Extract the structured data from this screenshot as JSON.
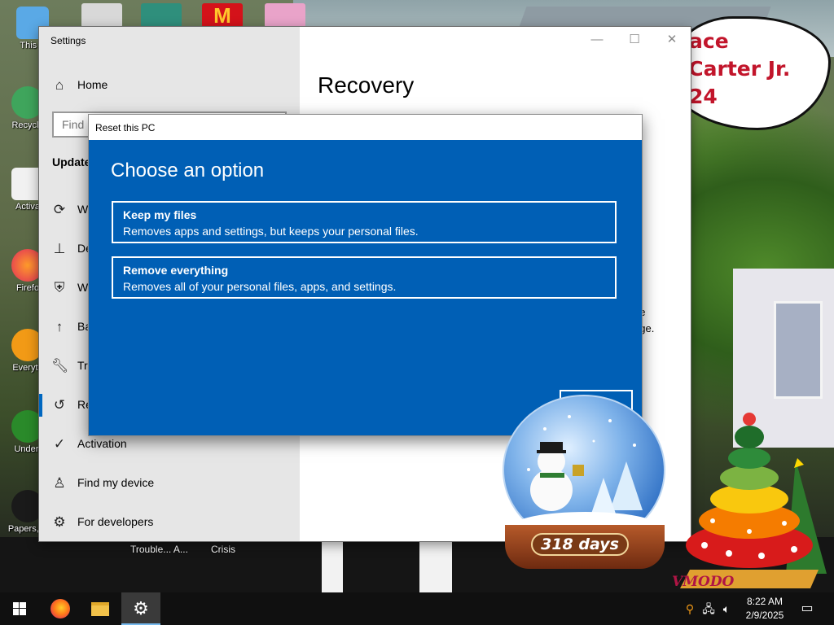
{
  "desktop": {
    "sign_lines": [
      "ace",
      "l Carter Jr.",
      "24"
    ],
    "icons": [
      {
        "label": "This P"
      },
      {
        "label": "Recycle"
      },
      {
        "label": "Activa"
      },
      {
        "label": "Firefo"
      },
      {
        "label": "Everyth"
      },
      {
        "label": "Undert"
      },
      {
        "label": "Papers, P"
      }
    ],
    "floor_labels": [
      "Trouble... A...",
      "Crisis"
    ]
  },
  "settings_window": {
    "title": "Settings",
    "controls": {
      "minimize": "—",
      "maximize": "☐",
      "close": "✕"
    },
    "home_label": "Home",
    "find_placeholder": "Find",
    "section_heading": "Update",
    "nav_items": [
      {
        "label": "W",
        "icon": "sync-icon"
      },
      {
        "label": "De",
        "icon": "delivery-icon"
      },
      {
        "label": "W",
        "icon": "shield-icon"
      },
      {
        "label": "Ba",
        "icon": "backup-icon"
      },
      {
        "label": "Tr",
        "icon": "wrench-icon"
      },
      {
        "label": "Re",
        "icon": "recovery-icon"
      },
      {
        "label": "Activation",
        "icon": "check-circle-icon"
      },
      {
        "label": "Find my device",
        "icon": "person-icon"
      },
      {
        "label": "For developers",
        "icon": "developer-icon"
      }
    ],
    "page_title": "Recovery",
    "right_fragments": [
      "ge",
      "age."
    ]
  },
  "reset_dialog": {
    "title": "Reset this PC",
    "heading": "Choose an option",
    "options": [
      {
        "title": "Keep my files",
        "description": "Removes apps and settings, but keeps your personal files."
      },
      {
        "title": "Remove everything",
        "description": "Removes all of your personal files, apps, and settings."
      }
    ]
  },
  "snow_globe": {
    "days_text": "318 days"
  },
  "tree_caption": "VMODO",
  "taskbar": {
    "apps": [
      {
        "name": "start-button"
      },
      {
        "name": "firefox-button"
      },
      {
        "name": "file-explorer-button"
      },
      {
        "name": "settings-button",
        "active": true
      }
    ],
    "clock": {
      "time": "8:22 AM",
      "date": "2/9/2025"
    }
  },
  "colors": {
    "dialog_blue": "#005fb5",
    "accent": "#0067c0",
    "taskbar": "#101010",
    "sign_red": "#c2152b"
  }
}
